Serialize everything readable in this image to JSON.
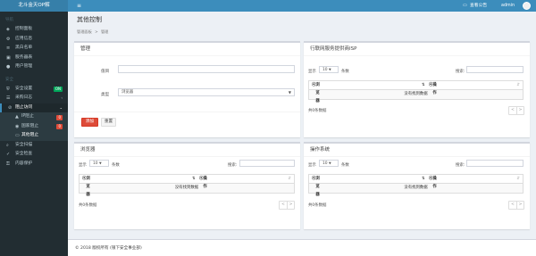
{
  "brand": "北斗金天OP解",
  "topbar": {
    "menu_icon": "hamburger-icon",
    "report_label": "查看公告",
    "user_name": "admin"
  },
  "sidebar": {
    "section1": "导航",
    "section2": "安全",
    "items": [
      {
        "label": "控制面板",
        "icon": "dashboard-icon"
      },
      {
        "label": "应用信息",
        "icon": "gear-icon"
      },
      {
        "label": "黑白名单",
        "icon": "list-icon"
      },
      {
        "label": "服务器表",
        "icon": "server-icon"
      },
      {
        "label": "用户管理",
        "icon": "user-icon"
      }
    ],
    "security_items": [
      {
        "label": "安全设置",
        "icon": "shield-icon",
        "badge": "ON",
        "badge_color": "#00a65a"
      },
      {
        "label": "采购日志",
        "icon": "log-icon"
      },
      {
        "label": "阻止访问",
        "icon": "block-icon"
      }
    ],
    "sub_items": [
      {
        "label": "IP阻止",
        "icon": "warning-icon",
        "badge": "0",
        "badge_color": "#dd4b39"
      },
      {
        "label": "国家阻止",
        "icon": "globe-icon",
        "badge": "0",
        "badge_color": "#dd4b39"
      },
      {
        "label": "其他阻止",
        "icon": "monitor-icon"
      }
    ],
    "bottom_items": [
      {
        "label": "安全扫描",
        "icon": "search-icon"
      },
      {
        "label": "安全检查",
        "icon": "check-icon"
      },
      {
        "label": "内容保护",
        "icon": "lock-icon"
      }
    ]
  },
  "page": {
    "title": "其他控制",
    "breadcrumb_home": "管理面板",
    "breadcrumb_sep": ">",
    "breadcrumb_current": "管理"
  },
  "manage": {
    "title": "管理",
    "value_label": "值目",
    "value_input": "",
    "type_label": "类型",
    "type_value": "浏览器",
    "add_button": "添加",
    "reset_button": "重置"
  },
  "isp_table": {
    "title": "行联网服务提供商ISP",
    "show_prefix": "显示",
    "show_value": "10",
    "show_suffix": "条数",
    "search_label": "搜索:",
    "col1": "浏览器",
    "col2": "操作",
    "empty": "没有找到数据",
    "summary": "共0条数据",
    "prev": "<",
    "next": ">"
  },
  "browser_table": {
    "title": "浏览器",
    "show_prefix": "显示",
    "show_value": "10",
    "show_suffix": "条数",
    "search_label": "搜索:",
    "col1": "浏览器",
    "col2": "操作",
    "empty": "没有找到数据",
    "summary": "共0条数据",
    "prev": "<",
    "next": ">"
  },
  "os_table": {
    "title": "操作系统",
    "show_prefix": "显示",
    "show_value": "10",
    "show_suffix": "条数",
    "search_label": "搜索:",
    "col1": "浏览器",
    "col2": "操作",
    "empty": "没有找到数据",
    "summary": "共0条数据",
    "prev": "<",
    "next": ">"
  },
  "footer": {
    "text": "© 2018 版权所有 (银下安全事业部)"
  }
}
